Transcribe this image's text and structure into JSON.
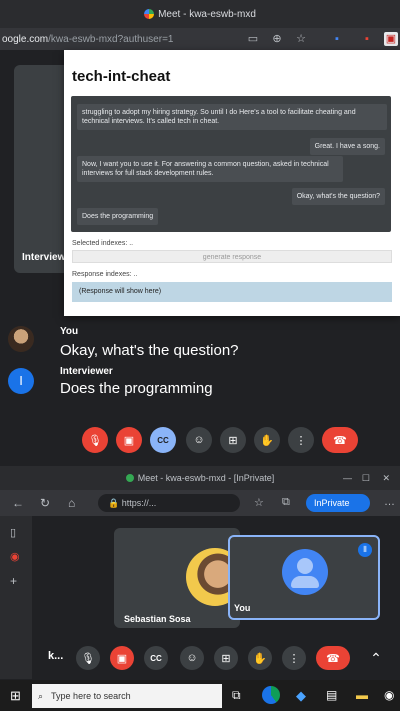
{
  "top_window": {
    "title": "Meet - kwa-eswb-mxd",
    "url_prefix": "oogle.com",
    "url_rest": "/kwa-eswb-mxd?authuser=1"
  },
  "meet_top": {
    "interviewer_tile_label": "Interviewer"
  },
  "popup": {
    "title": "tech-int-cheat",
    "messages": [
      "struggling to adopt my hiring strategy. So until I do Here's a tool to facilitate cheating and technical interviews. It's called tech in cheat.",
      "Great. I have a song.",
      "Now, I want you to use it. For answering a common question, asked in technical interviews for full stack development rules.",
      "Okay, what's the question?",
      "Does the programming"
    ],
    "selected_label": "Selected indexes: ..",
    "generate_button": "generate response",
    "response_label": "Response indexes: ..",
    "response_placeholder": "(Response will show here)"
  },
  "captions": [
    {
      "speaker": "You",
      "text": "Okay, what's the question?"
    },
    {
      "speaker": "Interviewer",
      "text": "Does the programming",
      "initial": "I"
    }
  ],
  "controls_top": [
    {
      "icon": "mic-off-icon",
      "color": "#ea4335"
    },
    {
      "icon": "camera-off-icon",
      "color": "#ea4335"
    },
    {
      "icon": "captions-icon",
      "color": "#8ab4f8"
    },
    {
      "icon": "emoji-icon",
      "color": "#3c4043"
    },
    {
      "icon": "present-icon",
      "color": "#3c4043"
    },
    {
      "icon": "raise-hand-icon",
      "color": "#3c4043"
    },
    {
      "icon": "more-icon",
      "color": "#3c4043"
    },
    {
      "icon": "end-call-icon",
      "color": "#ea4335"
    }
  ],
  "bottom_window": {
    "title": "Meet - kwa-eswb-mxd - [InPrivate]",
    "url": "https://...",
    "inprivate_label": "InPrivate",
    "participant_name": "Sebastian Sosa",
    "self_label": "You",
    "meeting_code_short": "k..."
  },
  "taskbar": {
    "search_placeholder": "Type here to search"
  }
}
